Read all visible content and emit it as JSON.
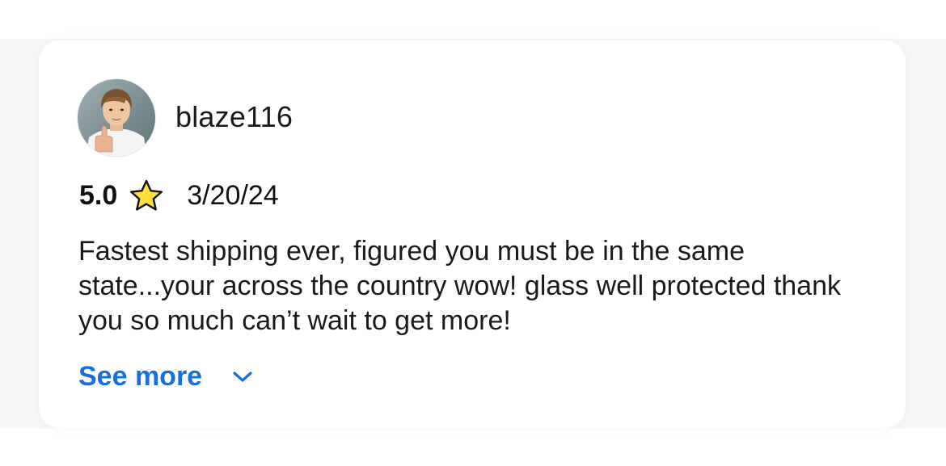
{
  "review": {
    "username": "blaze116",
    "avatar_icon": "user-avatar-photo",
    "rating": "5.0",
    "rating_icon": "star-icon",
    "date": "3/20/24",
    "text": "Fastest shipping ever, figured you must be in the same state...your across the country wow! glass well protected thank you so much can’t wait to get more!",
    "see_more_label": "See more",
    "see_more_icon": "chevron-down-icon"
  },
  "colors": {
    "link": "#1a6fde",
    "star_fill": "#fde03a",
    "star_stroke": "#111111",
    "text": "#1a1a1a",
    "backdrop": "#f7f7f8"
  }
}
